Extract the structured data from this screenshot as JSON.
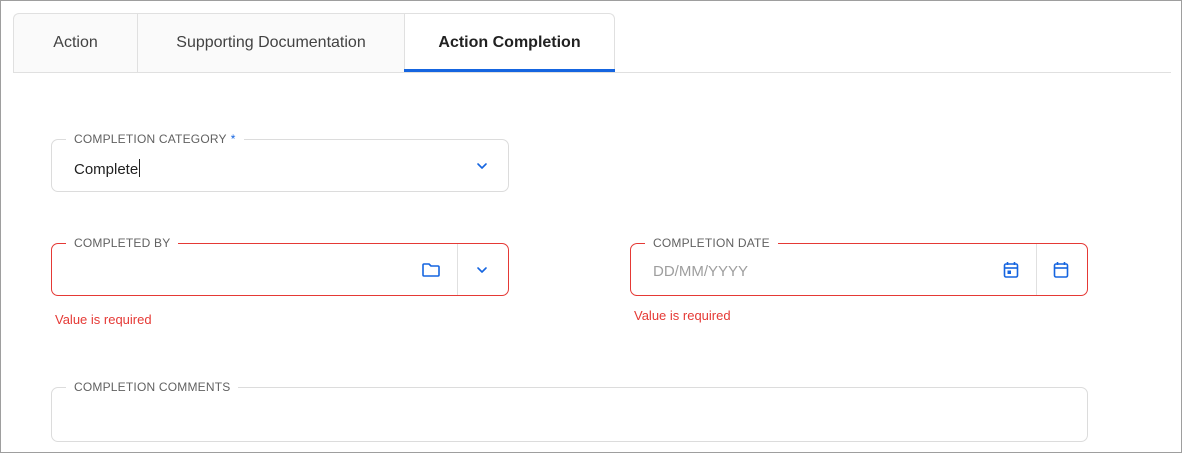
{
  "tabs": [
    {
      "label": "Action"
    },
    {
      "label": "Supporting Documentation"
    },
    {
      "label": "Action Completion"
    }
  ],
  "completion_category": {
    "label": "COMPLETION CATEGORY",
    "required_mark": "*",
    "value": "Complete",
    "icon": "chevron-down-icon"
  },
  "completed_by": {
    "label": "COMPLETED BY",
    "value": "",
    "error": "Value is required",
    "icons": [
      "folder-icon",
      "chevron-down-icon"
    ]
  },
  "completion_date": {
    "label": "COMPLETION DATE",
    "placeholder": "DD/MM/YYYY",
    "error": "Value is required",
    "icons": [
      "calendar-today-icon",
      "calendar-icon"
    ]
  },
  "completion_comments": {
    "label": "COMPLETION COMMENTS",
    "value": ""
  },
  "colors": {
    "accent": "#1565e0",
    "error": "#e53935",
    "border": "#dcdcdc"
  }
}
